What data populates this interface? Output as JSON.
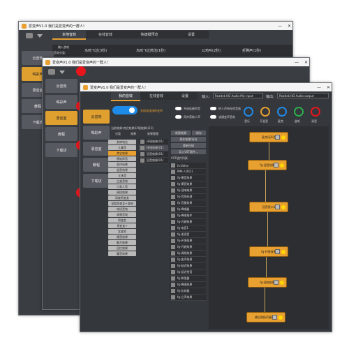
{
  "app": {
    "title": "爱变声V1.0  我们是爱变声的一群人!"
  },
  "window_controls": {
    "minimize": "—",
    "close": "✕"
  },
  "win1": {
    "tabs": [
      "本地音效",
      "在线音效",
      "快捷键预览",
      "设置"
    ],
    "row_labels": [
      "输入游戏",
      "音效分类:"
    ],
    "items": [
      "鸟鸣飞过(3秒)",
      "鸟鸣飞过简洁(1秒)",
      "公鸡叫(2秒)",
      "折腾声(1秒)"
    ],
    "side": [
      "云音效",
      "喝彩声",
      "录音室",
      "教程",
      "下载坊"
    ]
  },
  "win2": {
    "side": [
      "云音效",
      "喝彩声",
      "录音室",
      "教程",
      "下载坊"
    ]
  },
  "win3": {
    "tabs": [
      "我的音效",
      "在线音效",
      "设置"
    ],
    "input_label": "输入:",
    "input_device": "Realtek HD Audio Mic input",
    "output_label": "输出:",
    "output_device": "Realtek HD Audio output",
    "switch_main": "关闭该连接的变声",
    "toggles": [
      "开启连接声音",
      "同步获取人声",
      "双耳所听",
      "同时录音",
      "把人声所在的音效",
      "该通变声音效"
    ],
    "knobs": [
      "音乐",
      "不混音",
      "麦克",
      "监听",
      "录音"
    ],
    "side": [
      "云音效",
      "喝彩声",
      "录音室",
      "教程",
      "下载坊"
    ],
    "list_header": "当前效果:其它效果(环境效果)(21)",
    "col_headers": [
      "分类",
      "效果",
      "效果管理"
    ],
    "cats": [
      "女转电台",
      "儿童音",
      "其它效果",
      "原始声音",
      "室内场景",
      "混音效果",
      "立体音",
      "企变音效",
      "小男人音",
      "搞怪效果",
      "深度男变女",
      "深度男变女+混响",
      "电话音效",
      "调频音效",
      "男变女",
      "男变女+",
      "女变男",
      "播音效果",
      "魅力效果",
      "回忆效果",
      "魔音效果"
    ],
    "effects": [
      "环境效果(01)",
      "环境效果(01)",
      "回音效果(01)",
      "回音效果(01)"
    ],
    "mid_buttons": [
      "新建效果",
      "保存",
      "保存效果/另存",
      "重新扫描",
      "导入VST插件..."
    ],
    "vst_header": "VST插件列表:",
    "vst_list": [
      "fx:Valve",
      "MM-人声(1)",
      "fg-模音效果",
      "fg-模音效果",
      "fg-混响效果",
      "fg-音频处理",
      "fg-音量效果",
      "fg-降噪器",
      "fg-降噪插件",
      "fg-闪避效果",
      "fg-电音1",
      "fg-逆混音",
      "fg-环境效果",
      "fg-闪避效果",
      "fg-调频效果",
      "fg-变声效果",
      "fg-延迟效果",
      "fg-延迟拾音",
      "fg-和弦器",
      "fg-降噪效果",
      "fg-比较器",
      "fg-立声效果"
    ],
    "chain": [
      "麦克风声音",
      "fg-混音效果",
      "回音接口1",
      "fg-环境效果",
      "fg-混响效果",
      "输出到扬声器装置"
    ]
  }
}
